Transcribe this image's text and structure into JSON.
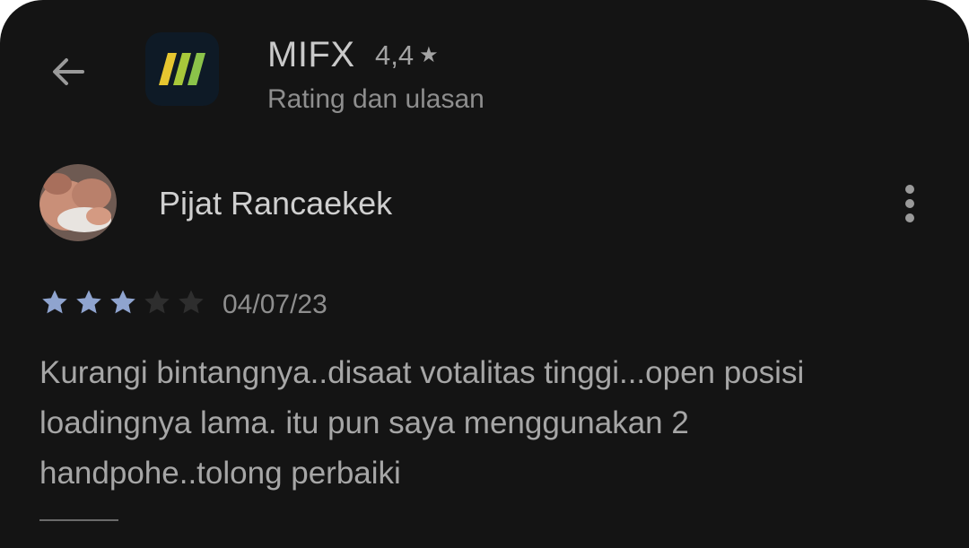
{
  "header": {
    "app_name": "MIFX",
    "app_rating": "4,4",
    "subtitle": "Rating dan ulasan",
    "back_icon": "arrow-back-icon",
    "app_icon": "mifx-logo-icon"
  },
  "review": {
    "author": "Pijat Rancaekek",
    "rating": 3,
    "max_rating": 5,
    "date": "04/07/23",
    "text": "Kurangi bintangnya..disaat votalitas tinggi...open posisi loadingnya lama. itu pun saya menggunakan 2 handpohe..tolong perbaiki",
    "more_icon": "more-vert-icon"
  },
  "colors": {
    "background": "#141414",
    "star_filled": "#8fa4cf",
    "star_empty": "#2e2e2e",
    "logo_green": "#8bc34a",
    "logo_yellow": "#e6c630"
  }
}
